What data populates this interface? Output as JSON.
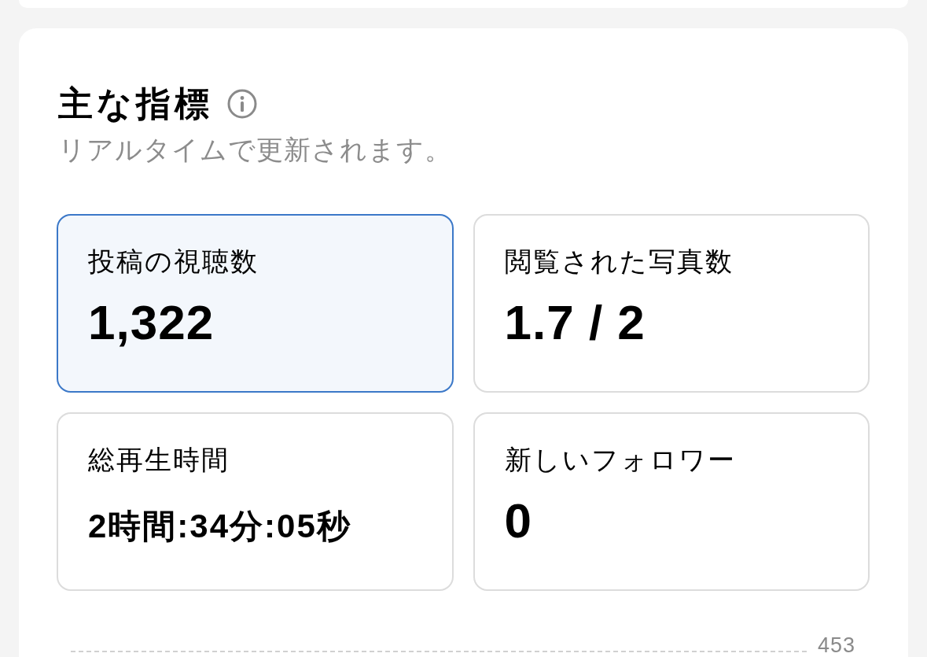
{
  "section": {
    "title": "主な指標",
    "subtitle": "リアルタイムで更新されます。"
  },
  "metrics": [
    {
      "label": "投稿の視聴数",
      "value": "1,322",
      "selected": true,
      "kind": "number"
    },
    {
      "label": "閲覧された写真数",
      "value": "1.7 / 2",
      "selected": false,
      "kind": "number"
    },
    {
      "label": "総再生時間",
      "value": "2時間:34分:05秒",
      "selected": false,
      "kind": "duration"
    },
    {
      "label": "新しいフォロワー",
      "value": "0",
      "selected": false,
      "kind": "number"
    }
  ],
  "chart": {
    "gridline_labels": [
      "453"
    ]
  }
}
